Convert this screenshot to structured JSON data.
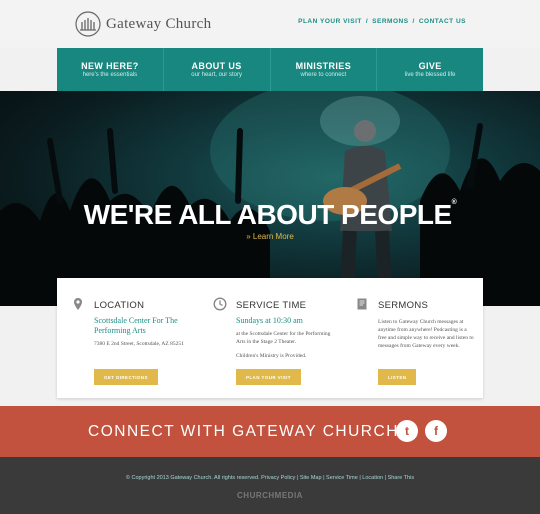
{
  "header": {
    "logo_text": "Gateway Church",
    "links": [
      "PLAN YOUR VISIT",
      "SERMONS",
      "CONTACT US"
    ],
    "separator": "/"
  },
  "nav": [
    {
      "title": "NEW HERE?",
      "sub": "here's the essentials"
    },
    {
      "title": "ABOUT US",
      "sub": "our heart, our story"
    },
    {
      "title": "MINISTRIES",
      "sub": "where to connect"
    },
    {
      "title": "GIVE",
      "sub": "live the blessed life"
    }
  ],
  "hero": {
    "title": "WE'RE ALL ABOUT PEOPLE",
    "trademark": "®",
    "learn_more": "» Learn More"
  },
  "cards": {
    "location": {
      "title": "LOCATION",
      "link": "Scottsdale Center For The Performing Arts",
      "text": "7380 E 2nd Street, Scottsdale, AZ 85251",
      "button": "GET DIRECTIONS"
    },
    "service": {
      "title": "SERVICE TIME",
      "link": "Sundays at 10:30 am",
      "text": "at the Scottsdale Center for the Performing Arts in the Stage 2 Theater.",
      "text2": "Children's Ministry is Provided.",
      "button": "PLAN YOUR VISIT"
    },
    "sermons": {
      "title": "SERMONS",
      "text": "Listen to Gateway Church messages at anytime from anywhere! Podcasting is a free and simple way to receive and listen to messages from Gateway every week.",
      "button": "LISTEN"
    }
  },
  "connect": {
    "text": "CONNECT WITH GATEWAY CHURCH",
    "twitter": "t",
    "facebook": "f"
  },
  "footer": {
    "copyright": "© Copyright 2013 Gateway Church. All rights reserved.   Privacy Policy  |  Site Map  |  Service Time  |  Location  |  Share This",
    "brand": "CHURCHMEDIA"
  },
  "colors": {
    "teal": "#18877f",
    "gold": "#e0b94a",
    "red": "#c2523e",
    "dark": "#3a3a3a"
  }
}
